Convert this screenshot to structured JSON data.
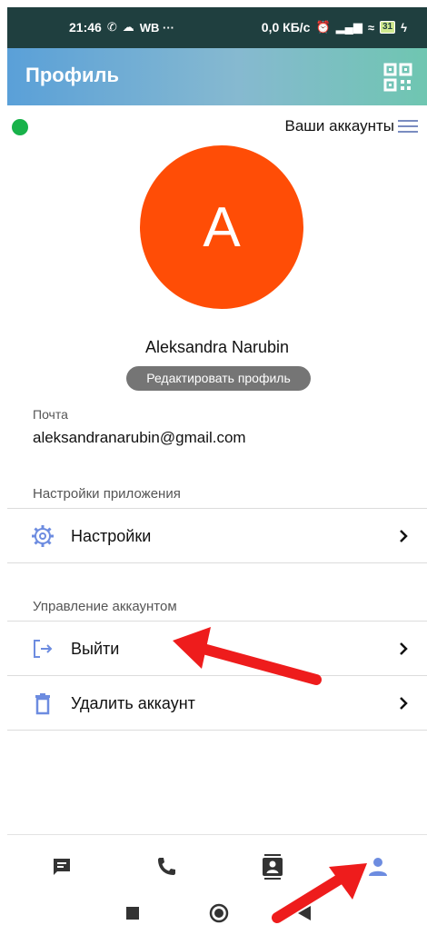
{
  "status_bar": {
    "time": "21:46",
    "left_extra": "WB  ···",
    "network_speed": "0,0 КБ/с",
    "battery": "31"
  },
  "app_bar": {
    "title": "Профиль",
    "qr_icon": "qr-code-icon"
  },
  "top_row": {
    "accounts_label": "Ваши аккаунты",
    "online_color": "#18b24a"
  },
  "profile": {
    "avatar_letter": "A",
    "avatar_color": "#ff4d06",
    "name": "Aleksandra Narubin",
    "edit_button": "Редактировать профиль",
    "mail_label": "Почта",
    "mail_value": "aleksandranarubin@gmail.com"
  },
  "sections": {
    "app_settings_title": "Настройки приложения",
    "settings_item": "Настройки",
    "account_management_title": "Управление аккаунтом",
    "logout_item": "Выйти",
    "delete_item": "Удалить аккаунт"
  },
  "bottom_nav": {
    "items": [
      "chat-icon",
      "phone-icon",
      "contacts-icon",
      "profile-icon"
    ],
    "active": "profile-icon",
    "active_color": "#6d8ce0"
  },
  "annotations": {
    "arrow_color": "#ee1c1c"
  }
}
